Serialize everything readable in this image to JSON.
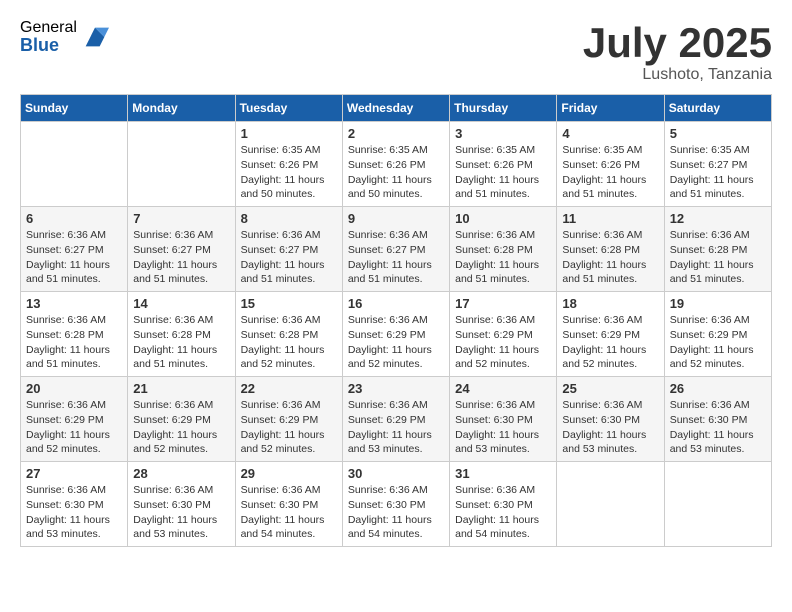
{
  "logo": {
    "general": "General",
    "blue": "Blue"
  },
  "title": {
    "month": "July 2025",
    "location": "Lushoto, Tanzania"
  },
  "weekdays": [
    "Sunday",
    "Monday",
    "Tuesday",
    "Wednesday",
    "Thursday",
    "Friday",
    "Saturday"
  ],
  "weeks": [
    [
      {
        "day": null
      },
      {
        "day": null
      },
      {
        "day": "1",
        "sunrise": "6:35 AM",
        "sunset": "6:26 PM",
        "daylight": "11 hours and 50 minutes."
      },
      {
        "day": "2",
        "sunrise": "6:35 AM",
        "sunset": "6:26 PM",
        "daylight": "11 hours and 50 minutes."
      },
      {
        "day": "3",
        "sunrise": "6:35 AM",
        "sunset": "6:26 PM",
        "daylight": "11 hours and 51 minutes."
      },
      {
        "day": "4",
        "sunrise": "6:35 AM",
        "sunset": "6:26 PM",
        "daylight": "11 hours and 51 minutes."
      },
      {
        "day": "5",
        "sunrise": "6:35 AM",
        "sunset": "6:27 PM",
        "daylight": "11 hours and 51 minutes."
      }
    ],
    [
      {
        "day": "6",
        "sunrise": "6:36 AM",
        "sunset": "6:27 PM",
        "daylight": "11 hours and 51 minutes."
      },
      {
        "day": "7",
        "sunrise": "6:36 AM",
        "sunset": "6:27 PM",
        "daylight": "11 hours and 51 minutes."
      },
      {
        "day": "8",
        "sunrise": "6:36 AM",
        "sunset": "6:27 PM",
        "daylight": "11 hours and 51 minutes."
      },
      {
        "day": "9",
        "sunrise": "6:36 AM",
        "sunset": "6:27 PM",
        "daylight": "11 hours and 51 minutes."
      },
      {
        "day": "10",
        "sunrise": "6:36 AM",
        "sunset": "6:28 PM",
        "daylight": "11 hours and 51 minutes."
      },
      {
        "day": "11",
        "sunrise": "6:36 AM",
        "sunset": "6:28 PM",
        "daylight": "11 hours and 51 minutes."
      },
      {
        "day": "12",
        "sunrise": "6:36 AM",
        "sunset": "6:28 PM",
        "daylight": "11 hours and 51 minutes."
      }
    ],
    [
      {
        "day": "13",
        "sunrise": "6:36 AM",
        "sunset": "6:28 PM",
        "daylight": "11 hours and 51 minutes."
      },
      {
        "day": "14",
        "sunrise": "6:36 AM",
        "sunset": "6:28 PM",
        "daylight": "11 hours and 51 minutes."
      },
      {
        "day": "15",
        "sunrise": "6:36 AM",
        "sunset": "6:28 PM",
        "daylight": "11 hours and 52 minutes."
      },
      {
        "day": "16",
        "sunrise": "6:36 AM",
        "sunset": "6:29 PM",
        "daylight": "11 hours and 52 minutes."
      },
      {
        "day": "17",
        "sunrise": "6:36 AM",
        "sunset": "6:29 PM",
        "daylight": "11 hours and 52 minutes."
      },
      {
        "day": "18",
        "sunrise": "6:36 AM",
        "sunset": "6:29 PM",
        "daylight": "11 hours and 52 minutes."
      },
      {
        "day": "19",
        "sunrise": "6:36 AM",
        "sunset": "6:29 PM",
        "daylight": "11 hours and 52 minutes."
      }
    ],
    [
      {
        "day": "20",
        "sunrise": "6:36 AM",
        "sunset": "6:29 PM",
        "daylight": "11 hours and 52 minutes."
      },
      {
        "day": "21",
        "sunrise": "6:36 AM",
        "sunset": "6:29 PM",
        "daylight": "11 hours and 52 minutes."
      },
      {
        "day": "22",
        "sunrise": "6:36 AM",
        "sunset": "6:29 PM",
        "daylight": "11 hours and 52 minutes."
      },
      {
        "day": "23",
        "sunrise": "6:36 AM",
        "sunset": "6:29 PM",
        "daylight": "11 hours and 53 minutes."
      },
      {
        "day": "24",
        "sunrise": "6:36 AM",
        "sunset": "6:30 PM",
        "daylight": "11 hours and 53 minutes."
      },
      {
        "day": "25",
        "sunrise": "6:36 AM",
        "sunset": "6:30 PM",
        "daylight": "11 hours and 53 minutes."
      },
      {
        "day": "26",
        "sunrise": "6:36 AM",
        "sunset": "6:30 PM",
        "daylight": "11 hours and 53 minutes."
      }
    ],
    [
      {
        "day": "27",
        "sunrise": "6:36 AM",
        "sunset": "6:30 PM",
        "daylight": "11 hours and 53 minutes."
      },
      {
        "day": "28",
        "sunrise": "6:36 AM",
        "sunset": "6:30 PM",
        "daylight": "11 hours and 53 minutes."
      },
      {
        "day": "29",
        "sunrise": "6:36 AM",
        "sunset": "6:30 PM",
        "daylight": "11 hours and 54 minutes."
      },
      {
        "day": "30",
        "sunrise": "6:36 AM",
        "sunset": "6:30 PM",
        "daylight": "11 hours and 54 minutes."
      },
      {
        "day": "31",
        "sunrise": "6:36 AM",
        "sunset": "6:30 PM",
        "daylight": "11 hours and 54 minutes."
      },
      {
        "day": null
      },
      {
        "day": null
      }
    ]
  ]
}
